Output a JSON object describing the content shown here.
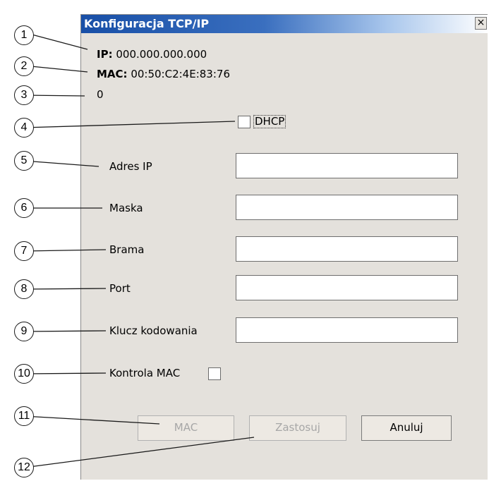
{
  "dialog": {
    "title": "Konfiguracja TCP/IP",
    "close_glyph": "×",
    "ip_label": "IP:",
    "ip_value": "000.000.000.000",
    "mac_label": "MAC:",
    "mac_value": "00:50:C2:4E:83:76",
    "status_value": "0",
    "dhcp_label": "DHCP",
    "dhcp_checked": false,
    "fields": {
      "ip_label": "Adres IP",
      "ip_value": "",
      "mask_label": "Maska",
      "mask_value": "",
      "gateway_label": "Brama",
      "gateway_value": "",
      "port_label": "Port",
      "port_value": "",
      "key_label": "Klucz kodowania",
      "key_value": ""
    },
    "mac_control_label": "Kontrola MAC",
    "mac_control_checked": false,
    "buttons": {
      "mac": "MAC",
      "apply": "Zastosuj",
      "cancel": "Anuluj"
    }
  },
  "callouts": [
    "1",
    "2",
    "3",
    "4",
    "5",
    "6",
    "7",
    "8",
    "9",
    "10",
    "11",
    "12"
  ]
}
